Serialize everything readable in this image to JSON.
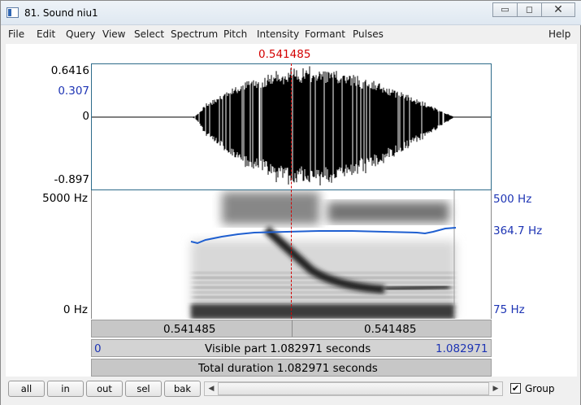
{
  "window": {
    "title": "81. Sound niu1",
    "minimize_glyph": "▭",
    "maximize_glyph": "◻",
    "close_glyph": "✕"
  },
  "menu": [
    "File",
    "Edit",
    "Query",
    "View",
    "Select",
    "Spectrum",
    "Pitch",
    "Intensity",
    "Formant",
    "Pulses"
  ],
  "menu_help": "Help",
  "cursor_time": "0.541485",
  "waveform": {
    "max_label": "0.6416",
    "cursor_value_label": "0.307",
    "zero_label": "0",
    "min_label": "-0.897"
  },
  "spectrogram": {
    "top_freq": "5000 Hz",
    "bottom_freq": "0 Hz",
    "pitch_top": "500 Hz",
    "pitch_value": "364.7 Hz",
    "pitch_bottom": "75 Hz"
  },
  "time_bars": {
    "left_segment": "0.541485",
    "right_segment": "0.541485",
    "visible_start": "0",
    "visible_text": "Visible part 1.082971 seconds",
    "visible_end": "1.082971",
    "total_text": "Total duration 1.082971 seconds"
  },
  "toolbar": {
    "all": "all",
    "in": "in",
    "out": "out",
    "sel": "sel",
    "bak": "bak",
    "left_arrow": "◀",
    "right_arrow": "▶",
    "group_checked": "✔",
    "group_label": "Group"
  },
  "colors": {
    "cursor": "#d40000",
    "pitch": "#1f5fd0",
    "axis_blue": "#1d34b4"
  }
}
